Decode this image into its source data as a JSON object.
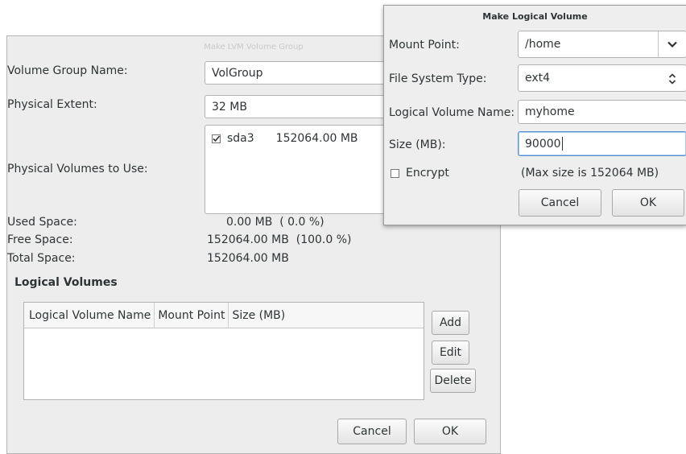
{
  "lvm_dialog": {
    "title": "Make LVM Volume Group",
    "volume_group_name_label": "Volume Group Name:",
    "volume_group_name_value": "VolGroup",
    "physical_extent_label": "Physical Extent:",
    "physical_extent_value": "32 MB",
    "physical_volumes_label": "Physical Volumes to Use:",
    "physical_volumes": [
      {
        "checked": true,
        "name": "sda3",
        "size": "152064.00 MB"
      }
    ],
    "used_space_label": "Used Space:",
    "used_space_value": "0.00 MB  ( 0.0 %)",
    "free_space_label": "Free Space:",
    "free_space_value": "152064.00 MB  (100.0 %)",
    "total_space_label": "Total Space:",
    "total_space_value": "152064.00 MB",
    "logical_volumes_heading": "Logical Volumes",
    "table_columns": [
      "Logical Volume Name",
      "Mount Point",
      "Size (MB)"
    ],
    "add_label": "Add",
    "edit_label": "Edit",
    "delete_label": "Delete",
    "cancel_label": "Cancel",
    "ok_label": "OK"
  },
  "lv_dialog": {
    "title": "Make Logical Volume",
    "mount_point_label": "Mount Point:",
    "mount_point_value": "/home",
    "fs_type_label": "File System Type:",
    "fs_type_value": "ext4",
    "lv_name_label": "Logical Volume Name:",
    "lv_name_value": "myhome",
    "size_label": "Size (MB):",
    "size_value": "90000",
    "encrypt_label": "Encrypt",
    "max_size_text": "(Max size is 152064 MB)",
    "cancel_label": "Cancel",
    "ok_label": "OK"
  },
  "icons": {
    "dropdown": "chevron-down-icon",
    "spinner": "updown-icon",
    "checkbox": "checkbox-icon"
  }
}
